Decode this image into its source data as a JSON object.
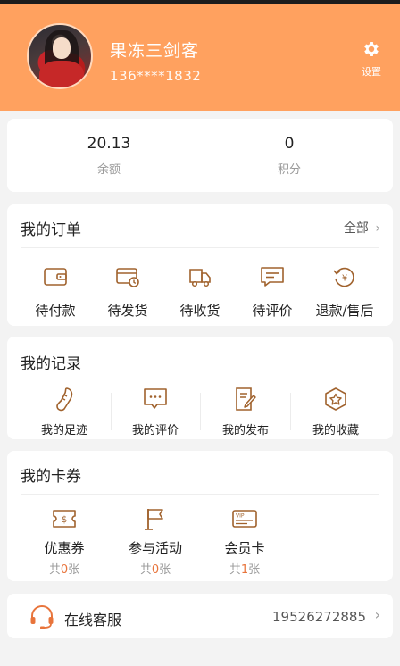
{
  "profile": {
    "username": "果冻三剑客",
    "phone": "136****1832",
    "settings_label": "设置"
  },
  "stats": {
    "balance_value": "20.13",
    "balance_label": "余额",
    "points_value": "0",
    "points_label": "积分"
  },
  "orders": {
    "title": "我的订单",
    "all_label": "全部",
    "items": [
      {
        "label": "待付款",
        "icon": "wallet-icon"
      },
      {
        "label": "待发货",
        "icon": "shipping-pending-icon"
      },
      {
        "label": "待收货",
        "icon": "delivery-truck-icon"
      },
      {
        "label": "待评价",
        "icon": "review-comment-icon"
      },
      {
        "label": "退款/售后",
        "icon": "refund-icon"
      }
    ]
  },
  "records": {
    "title": "我的记录",
    "items": [
      {
        "label": "我的足迹",
        "icon": "footprint-icon"
      },
      {
        "label": "我的评价",
        "icon": "chat-bubble-icon"
      },
      {
        "label": "我的发布",
        "icon": "edit-document-icon"
      },
      {
        "label": "我的收藏",
        "icon": "star-favorite-icon"
      }
    ]
  },
  "coupons": {
    "title": "我的卡券",
    "items": [
      {
        "label": "优惠券",
        "count_prefix": "共",
        "count": "0",
        "count_suffix": "张",
        "icon": "coupon-icon"
      },
      {
        "label": "参与活动",
        "count_prefix": "共",
        "count": "0",
        "count_suffix": "张",
        "icon": "flag-icon"
      },
      {
        "label": "会员卡",
        "count_prefix": "共",
        "count": "1",
        "count_suffix": "张",
        "icon": "vip-card-icon"
      }
    ]
  },
  "service": {
    "label": "在线客服",
    "phone": "19526272885",
    "icon": "headset-icon"
  },
  "colors": {
    "header_bg": "#ffa15f",
    "icon_brown": "#a0622d",
    "count_accent": "#e8743b"
  }
}
